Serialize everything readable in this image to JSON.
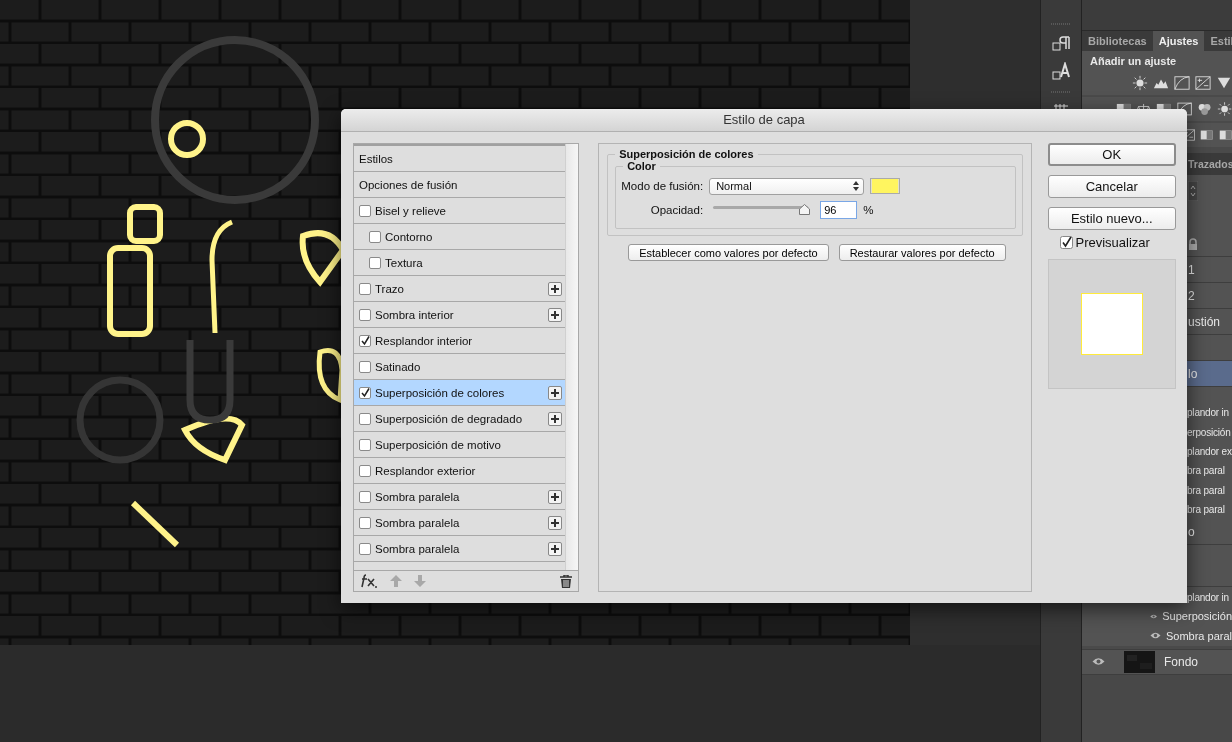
{
  "panel": {
    "tabs": [
      {
        "label": "Bibliotecas",
        "selected": false
      },
      {
        "label": "Ajustes",
        "selected": true
      },
      {
        "label": "Estil",
        "selected": false
      }
    ],
    "adjust_title": "Añadir un ajuste",
    "layers_tab": "Trazados",
    "rows": [
      {
        "kind": "lock",
        "selected": false
      },
      {
        "kind": "layer",
        "label": "1",
        "selected": false
      },
      {
        "kind": "layer",
        "label": "2",
        "selected": false
      },
      {
        "kind": "layer",
        "label": "ustión",
        "selected": false
      },
      {
        "kind": "blank",
        "selected": false
      },
      {
        "kind": "layer",
        "label": "lo",
        "selected": true
      },
      {
        "kind": "blank_short",
        "selected": false
      },
      {
        "kind": "effect",
        "label": "plandor in",
        "selected": false
      },
      {
        "kind": "effect",
        "label": "erposición",
        "selected": false
      },
      {
        "kind": "effect",
        "label": "plandor ex",
        "selected": false
      },
      {
        "kind": "effect",
        "label": "bra paral",
        "selected": false
      },
      {
        "kind": "effect",
        "label": "bra paral",
        "selected": false
      },
      {
        "kind": "effect",
        "label": "bra paral",
        "selected": false
      },
      {
        "kind": "layer",
        "label": "o",
        "selected": false
      },
      {
        "kind": "blank_tall",
        "selected": false
      },
      {
        "kind": "effect",
        "label": "plandor in",
        "selected": false
      },
      {
        "kind": "visible_effect",
        "label": "Superposición",
        "selected": false
      },
      {
        "kind": "visible_effect",
        "label": "Sombra paral",
        "selected": false
      },
      {
        "kind": "background",
        "label": "Fondo",
        "selected": false
      }
    ]
  },
  "dialog": {
    "title": "Estilo de capa",
    "styles": [
      {
        "kind": "header",
        "label": "Estilos",
        "selected": false
      },
      {
        "kind": "header",
        "label": "Opciones de fusión",
        "selected": false
      },
      {
        "kind": "effect",
        "label": "Bisel y relieve",
        "checked": false,
        "add_button": false,
        "selected": false,
        "children": [
          {
            "kind": "effect",
            "label": "Contorno",
            "checked": false,
            "add_button": false,
            "selected": false
          },
          {
            "kind": "effect",
            "label": "Textura",
            "checked": false,
            "add_button": false,
            "selected": false
          }
        ]
      },
      {
        "kind": "effect",
        "label": "Trazo",
        "checked": false,
        "add_button": true,
        "selected": false
      },
      {
        "kind": "effect",
        "label": "Sombra interior",
        "checked": false,
        "add_button": true,
        "selected": false
      },
      {
        "kind": "effect",
        "label": "Resplandor interior",
        "checked": true,
        "add_button": false,
        "selected": false
      },
      {
        "kind": "effect",
        "label": "Satinado",
        "checked": false,
        "add_button": false,
        "selected": false
      },
      {
        "kind": "effect",
        "label": "Superposición de colores",
        "checked": true,
        "add_button": true,
        "selected": true
      },
      {
        "kind": "effect",
        "label": "Superposición de degradado",
        "checked": false,
        "add_button": true,
        "selected": false
      },
      {
        "kind": "effect",
        "label": "Superposición de motivo",
        "checked": false,
        "add_button": false,
        "selected": false
      },
      {
        "kind": "effect",
        "label": "Resplandor exterior",
        "checked": false,
        "add_button": false,
        "selected": false
      },
      {
        "kind": "effect",
        "label": "Sombra paralela",
        "checked": false,
        "add_button": true,
        "selected": false
      },
      {
        "kind": "effect",
        "label": "Sombra paralela",
        "checked": false,
        "add_button": true,
        "selected": false
      },
      {
        "kind": "effect",
        "label": "Sombra paralela",
        "checked": false,
        "add_button": true,
        "selected": false
      }
    ],
    "section_title": "Superposición de colores",
    "group_title": "Color",
    "blend_label": "Modo de fusión:",
    "blend_mode": "Normal",
    "color": "#fff55f",
    "opacity_label": "Opacidad:",
    "opacity": {
      "level": 0.96,
      "value": "96",
      "unit": "%"
    },
    "action_buttons": [
      "Establecer como valores por defecto",
      "Restaurar valores por defecto"
    ],
    "buttons": [
      {
        "label": "OK",
        "kind": "default"
      },
      {
        "label": "Cancelar",
        "kind": "normal"
      },
      {
        "label": "Estilo nuevo...",
        "kind": "normal"
      }
    ],
    "preview": {
      "label": "Previsualizar",
      "checked": true
    }
  }
}
